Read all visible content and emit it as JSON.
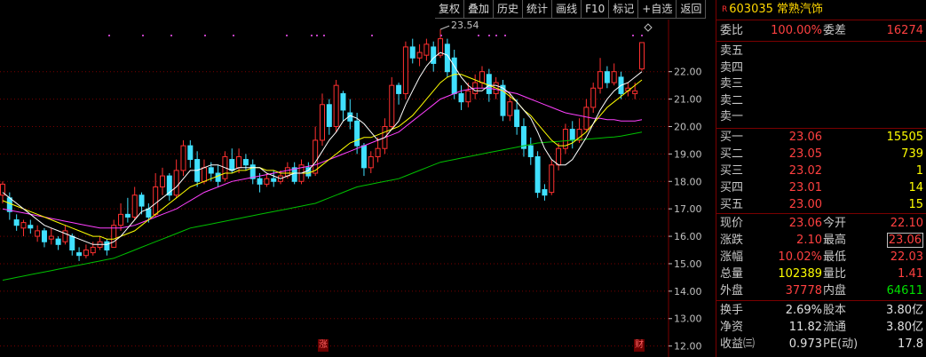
{
  "toolbar": {
    "buttons": [
      "复权",
      "叠加",
      "历史",
      "统计",
      "画线",
      "F10",
      "标记",
      "+自选",
      "返回"
    ]
  },
  "chart": {
    "max_label": "23.54",
    "price_ticks": [
      "22.00",
      "21.00",
      "20.00",
      "19.00",
      "18.00",
      "17.00",
      "16.00",
      "15.00",
      "14.00",
      "13.00",
      "12.00"
    ],
    "tags": {
      "zhang": "涨",
      "cai": "财"
    },
    "colors": {
      "up": "#ff3030",
      "down": "#40e0ff",
      "ma5": "#ffffff",
      "ma10": "#ffff00",
      "ma20": "#ff40ff",
      "ma60": "#00c000",
      "grid": "#7a0000"
    }
  },
  "chart_data": {
    "type": "candlestick",
    "ylim": [
      11.6,
      23.9
    ],
    "candles": [
      {
        "o": 17.5,
        "c": 17.9,
        "h": 18.0,
        "l": 17.2
      },
      {
        "o": 17.4,
        "c": 16.9,
        "h": 17.6,
        "l": 16.6
      },
      {
        "o": 16.6,
        "c": 16.4,
        "h": 16.8,
        "l": 16.2
      },
      {
        "o": 16.3,
        "c": 16.5,
        "h": 16.6,
        "l": 16.0
      },
      {
        "o": 16.4,
        "c": 16.3,
        "h": 16.6,
        "l": 16.1
      },
      {
        "o": 16.0,
        "c": 16.2,
        "h": 16.4,
        "l": 15.8
      },
      {
        "o": 16.2,
        "c": 15.8,
        "h": 16.3,
        "l": 15.6
      },
      {
        "o": 15.9,
        "c": 16.0,
        "h": 16.3,
        "l": 15.7
      },
      {
        "o": 15.9,
        "c": 15.7,
        "h": 16.0,
        "l": 15.5
      },
      {
        "o": 15.8,
        "c": 16.2,
        "h": 16.4,
        "l": 15.7
      },
      {
        "o": 16.0,
        "c": 15.5,
        "h": 16.1,
        "l": 15.3
      },
      {
        "o": 15.4,
        "c": 15.3,
        "h": 15.6,
        "l": 15.1
      },
      {
        "o": 15.3,
        "c": 15.5,
        "h": 15.7,
        "l": 15.2
      },
      {
        "o": 15.4,
        "c": 15.6,
        "h": 15.8,
        "l": 15.3
      },
      {
        "o": 15.6,
        "c": 15.8,
        "h": 16.0,
        "l": 15.5
      },
      {
        "o": 15.8,
        "c": 15.5,
        "h": 15.9,
        "l": 15.3
      },
      {
        "o": 15.6,
        "c": 16.4,
        "h": 16.6,
        "l": 15.6
      },
      {
        "o": 16.4,
        "c": 16.8,
        "h": 17.2,
        "l": 16.2
      },
      {
        "o": 16.8,
        "c": 16.7,
        "h": 17.4,
        "l": 16.5
      },
      {
        "o": 16.7,
        "c": 17.5,
        "h": 17.8,
        "l": 16.6
      },
      {
        "o": 17.5,
        "c": 17.1,
        "h": 17.6,
        "l": 16.8
      },
      {
        "o": 17.0,
        "c": 16.7,
        "h": 17.2,
        "l": 16.5
      },
      {
        "o": 16.8,
        "c": 17.8,
        "h": 18.3,
        "l": 16.7
      },
      {
        "o": 17.8,
        "c": 18.2,
        "h": 18.5,
        "l": 17.5
      },
      {
        "o": 18.2,
        "c": 17.5,
        "h": 18.3,
        "l": 17.3
      },
      {
        "o": 17.5,
        "c": 18.4,
        "h": 18.8,
        "l": 17.4
      },
      {
        "o": 18.4,
        "c": 19.3,
        "h": 19.5,
        "l": 18.2
      },
      {
        "o": 19.3,
        "c": 18.8,
        "h": 19.5,
        "l": 18.5
      },
      {
        "o": 18.8,
        "c": 18.0,
        "h": 19.1,
        "l": 17.8
      },
      {
        "o": 18.0,
        "c": 18.5,
        "h": 18.8,
        "l": 17.9
      },
      {
        "o": 18.5,
        "c": 18.3,
        "h": 18.7,
        "l": 18.0
      },
      {
        "o": 18.3,
        "c": 18.0,
        "h": 18.6,
        "l": 17.8
      },
      {
        "o": 18.1,
        "c": 18.9,
        "h": 19.1,
        "l": 18.0
      },
      {
        "o": 18.8,
        "c": 18.4,
        "h": 19.2,
        "l": 18.3
      },
      {
        "o": 18.5,
        "c": 18.9,
        "h": 19.2,
        "l": 18.3
      },
      {
        "o": 18.8,
        "c": 18.6,
        "h": 19.0,
        "l": 18.4
      },
      {
        "o": 18.6,
        "c": 18.1,
        "h": 18.8,
        "l": 17.9
      },
      {
        "o": 18.1,
        "c": 17.9,
        "h": 18.3,
        "l": 17.6
      },
      {
        "o": 17.9,
        "c": 18.1,
        "h": 18.3,
        "l": 17.8
      },
      {
        "o": 18.1,
        "c": 18.0,
        "h": 18.4,
        "l": 17.8
      },
      {
        "o": 18.0,
        "c": 18.2,
        "h": 18.4,
        "l": 17.9
      },
      {
        "o": 18.2,
        "c": 18.5,
        "h": 18.7,
        "l": 18.1
      },
      {
        "o": 18.5,
        "c": 18.0,
        "h": 18.7,
        "l": 17.9
      },
      {
        "o": 18.0,
        "c": 18.6,
        "h": 18.8,
        "l": 17.9
      },
      {
        "o": 18.5,
        "c": 18.2,
        "h": 18.7,
        "l": 18.1
      },
      {
        "o": 18.3,
        "c": 19.5,
        "h": 20.0,
        "l": 18.2
      },
      {
        "o": 19.5,
        "c": 20.8,
        "h": 21.2,
        "l": 19.3
      },
      {
        "o": 20.8,
        "c": 20.0,
        "h": 21.0,
        "l": 19.7
      },
      {
        "o": 20.0,
        "c": 21.5,
        "h": 21.7,
        "l": 19.8
      },
      {
        "o": 21.2,
        "c": 20.6,
        "h": 21.3,
        "l": 20.2
      },
      {
        "o": 20.5,
        "c": 20.2,
        "h": 21.0,
        "l": 19.9
      },
      {
        "o": 20.2,
        "c": 19.3,
        "h": 20.5,
        "l": 19.0
      },
      {
        "o": 19.3,
        "c": 18.5,
        "h": 19.4,
        "l": 18.2
      },
      {
        "o": 18.5,
        "c": 18.9,
        "h": 19.1,
        "l": 18.3
      },
      {
        "o": 18.9,
        "c": 19.2,
        "h": 19.6,
        "l": 18.7
      },
      {
        "o": 19.2,
        "c": 20.0,
        "h": 20.3,
        "l": 19.0
      },
      {
        "o": 20.0,
        "c": 21.5,
        "h": 21.8,
        "l": 19.9
      },
      {
        "o": 21.5,
        "c": 21.2,
        "h": 21.6,
        "l": 20.8
      },
      {
        "o": 21.2,
        "c": 22.9,
        "h": 23.1,
        "l": 21.0
      },
      {
        "o": 22.9,
        "c": 22.5,
        "h": 23.2,
        "l": 22.3
      },
      {
        "o": 22.5,
        "c": 22.7,
        "h": 23.0,
        "l": 22.2
      },
      {
        "o": 22.6,
        "c": 23.0,
        "h": 23.2,
        "l": 22.4
      },
      {
        "o": 22.9,
        "c": 22.3,
        "h": 23.1,
        "l": 22.0
      },
      {
        "o": 22.6,
        "c": 23.2,
        "h": 23.54,
        "l": 22.5
      },
      {
        "o": 23.0,
        "c": 22.0,
        "h": 23.2,
        "l": 21.8
      },
      {
        "o": 22.5,
        "c": 21.2,
        "h": 22.8,
        "l": 21.0
      },
      {
        "o": 21.2,
        "c": 20.9,
        "h": 21.5,
        "l": 20.6
      },
      {
        "o": 20.9,
        "c": 21.3,
        "h": 21.6,
        "l": 20.7
      },
      {
        "o": 21.2,
        "c": 21.6,
        "h": 21.9,
        "l": 21.0
      },
      {
        "o": 21.6,
        "c": 22.0,
        "h": 22.2,
        "l": 21.4
      },
      {
        "o": 21.9,
        "c": 21.2,
        "h": 22.1,
        "l": 20.9
      },
      {
        "o": 21.2,
        "c": 21.6,
        "h": 21.8,
        "l": 21.0
      },
      {
        "o": 21.5,
        "c": 20.4,
        "h": 21.7,
        "l": 20.2
      },
      {
        "o": 20.4,
        "c": 20.9,
        "h": 21.2,
        "l": 20.2
      },
      {
        "o": 20.6,
        "c": 20.0,
        "h": 21.0,
        "l": 19.7
      },
      {
        "o": 20.0,
        "c": 19.2,
        "h": 20.3,
        "l": 18.9
      },
      {
        "o": 19.3,
        "c": 18.9,
        "h": 19.6,
        "l": 18.6
      },
      {
        "o": 18.9,
        "c": 17.6,
        "h": 19.1,
        "l": 17.4
      },
      {
        "o": 17.7,
        "c": 17.5,
        "h": 17.9,
        "l": 17.3
      },
      {
        "o": 17.6,
        "c": 18.6,
        "h": 18.8,
        "l": 17.5
      },
      {
        "o": 18.6,
        "c": 19.2,
        "h": 19.4,
        "l": 18.4
      },
      {
        "o": 19.2,
        "c": 19.9,
        "h": 20.1,
        "l": 19.0
      },
      {
        "o": 19.9,
        "c": 19.5,
        "h": 20.2,
        "l": 19.2
      },
      {
        "o": 19.5,
        "c": 19.9,
        "h": 20.3,
        "l": 19.4
      },
      {
        "o": 19.9,
        "c": 20.7,
        "h": 21.0,
        "l": 19.8
      },
      {
        "o": 20.7,
        "c": 21.4,
        "h": 21.6,
        "l": 20.5
      },
      {
        "o": 21.4,
        "c": 22.0,
        "h": 22.5,
        "l": 21.2
      },
      {
        "o": 22.0,
        "c": 21.6,
        "h": 22.2,
        "l": 21.4
      },
      {
        "o": 21.6,
        "c": 22.0,
        "h": 22.3,
        "l": 21.5
      },
      {
        "o": 21.8,
        "c": 21.2,
        "h": 22.0,
        "l": 21.0
      },
      {
        "o": 21.3,
        "c": 21.4,
        "h": 21.6,
        "l": 21.1
      },
      {
        "o": 21.2,
        "c": 21.3,
        "h": 21.6,
        "l": 21.0
      },
      {
        "o": 22.1,
        "c": 23.06,
        "h": 23.06,
        "l": 22.03
      }
    ],
    "ma5": [
      17.6,
      17.4,
      17.2,
      17.0,
      16.8,
      16.6,
      16.4,
      16.3,
      16.2,
      16.1,
      16.0,
      15.9,
      15.8,
      15.7,
      15.7,
      15.7,
      15.8,
      16.0,
      16.3,
      16.6,
      16.9,
      17.0,
      17.2,
      17.4,
      17.6,
      17.8,
      18.1,
      18.4,
      18.4,
      18.5,
      18.6,
      18.6,
      18.5,
      18.4,
      18.5,
      18.5,
      18.5,
      18.5,
      18.3,
      18.2,
      18.1,
      18.2,
      18.3,
      18.3,
      18.4,
      18.7,
      19.1,
      19.5,
      19.8,
      20.2,
      20.4,
      20.3,
      20.1,
      19.8,
      19.5,
      19.6,
      19.9,
      20.2,
      20.8,
      21.3,
      21.8,
      22.2,
      22.5,
      22.7,
      22.6,
      22.2,
      21.8,
      21.5,
      21.3,
      21.3,
      21.5,
      21.5,
      21.4,
      21.2,
      20.9,
      20.6,
      20.3,
      19.8,
      19.2,
      18.8,
      18.6,
      18.6,
      18.8,
      19.2,
      19.6,
      20.1,
      20.6,
      21.0,
      21.3,
      21.5,
      21.6,
      21.8,
      22.0
    ],
    "ma10": [
      17.3,
      17.2,
      17.1,
      17.0,
      16.9,
      16.8,
      16.7,
      16.6,
      16.5,
      16.4,
      16.3,
      16.2,
      16.1,
      16.0,
      16.0,
      15.9,
      15.9,
      16.0,
      16.1,
      16.2,
      16.4,
      16.6,
      16.8,
      17.0,
      17.2,
      17.4,
      17.6,
      17.8,
      17.9,
      18.0,
      18.1,
      18.2,
      18.3,
      18.3,
      18.4,
      18.4,
      18.5,
      18.5,
      18.4,
      18.4,
      18.3,
      18.3,
      18.3,
      18.3,
      18.3,
      18.4,
      18.6,
      18.8,
      19.0,
      19.2,
      19.4,
      19.5,
      19.6,
      19.6,
      19.7,
      19.8,
      19.9,
      20.0,
      20.2,
      20.4,
      20.7,
      21.0,
      21.3,
      21.6,
      21.8,
      21.9,
      21.9,
      21.8,
      21.7,
      21.6,
      21.5,
      21.4,
      21.3,
      21.1,
      20.9,
      20.6,
      20.4,
      20.1,
      19.8,
      19.5,
      19.3,
      19.3,
      19.4,
      19.6,
      19.8,
      20.1,
      20.4,
      20.7,
      20.9,
      21.1,
      21.3,
      21.5,
      21.7
    ],
    "ma20": [
      17.0,
      16.95,
      16.9,
      16.85,
      16.8,
      16.75,
      16.7,
      16.65,
      16.6,
      16.55,
      16.5,
      16.45,
      16.4,
      16.35,
      16.3,
      16.3,
      16.3,
      16.3,
      16.35,
      16.4,
      16.5,
      16.6,
      16.7,
      16.8,
      16.9,
      17.0,
      17.15,
      17.3,
      17.45,
      17.6,
      17.7,
      17.8,
      17.9,
      18.0,
      18.05,
      18.1,
      18.15,
      18.2,
      18.25,
      18.3,
      18.35,
      18.4,
      18.45,
      18.5,
      18.55,
      18.6,
      18.7,
      18.8,
      18.9,
      19.0,
      19.1,
      19.2,
      19.3,
      19.4,
      19.5,
      19.6,
      19.7,
      19.8,
      20.0,
      20.2,
      20.4,
      20.6,
      20.8,
      21.0,
      21.1,
      21.2,
      21.3,
      21.35,
      21.4,
      21.4,
      21.4,
      21.35,
      21.3,
      21.25,
      21.2,
      21.1,
      21.0,
      20.9,
      20.8,
      20.7,
      20.6,
      20.5,
      20.45,
      20.4,
      20.35,
      20.3,
      20.3,
      20.25,
      20.25,
      20.2,
      20.2,
      20.2,
      20.25
    ],
    "ma60": [
      14.4,
      14.45,
      14.5,
      14.55,
      14.6,
      14.65,
      14.7,
      14.75,
      14.8,
      14.85,
      14.9,
      14.95,
      15.0,
      15.05,
      15.1,
      15.15,
      15.2,
      15.3,
      15.4,
      15.5,
      15.6,
      15.7,
      15.8,
      15.9,
      16.0,
      16.1,
      16.2,
      16.3,
      16.35,
      16.4,
      16.45,
      16.5,
      16.55,
      16.6,
      16.65,
      16.7,
      16.75,
      16.8,
      16.85,
      16.9,
      16.95,
      17.0,
      17.05,
      17.1,
      17.15,
      17.2,
      17.3,
      17.4,
      17.5,
      17.6,
      17.7,
      17.8,
      17.85,
      17.9,
      17.95,
      18.0,
      18.05,
      18.1,
      18.2,
      18.3,
      18.4,
      18.5,
      18.6,
      18.7,
      18.75,
      18.8,
      18.85,
      18.9,
      18.95,
      19.0,
      19.05,
      19.1,
      19.15,
      19.2,
      19.25,
      19.3,
      19.35,
      19.4,
      19.42,
      19.44,
      19.46,
      19.48,
      19.5,
      19.52,
      19.54,
      19.56,
      19.58,
      19.6,
      19.62,
      19.65,
      19.7,
      19.75,
      19.8
    ]
  },
  "quote": {
    "code": "603035",
    "name": "常熟汽饰",
    "r_mark": "R",
    "webi_label": "委比",
    "webi_value": "100.00%",
    "wecha_label": "委差",
    "wecha_value": "16274",
    "sell": [
      {
        "label": "卖五"
      },
      {
        "label": "卖四"
      },
      {
        "label": "卖三"
      },
      {
        "label": "卖二"
      },
      {
        "label": "卖一"
      }
    ],
    "buy": [
      {
        "label": "买一",
        "price": "23.06",
        "vol": "15505"
      },
      {
        "label": "买二",
        "price": "23.05",
        "vol": "739"
      },
      {
        "label": "买三",
        "price": "23.02",
        "vol": "1"
      },
      {
        "label": "买四",
        "price": "23.01",
        "vol": "14"
      },
      {
        "label": "买五",
        "price": "23.00",
        "vol": "15"
      }
    ],
    "stats": [
      {
        "l1": "现价",
        "v1": "23.06",
        "l2": "今开",
        "v2": "22.10"
      },
      {
        "l1": "涨跌",
        "v1": "2.10",
        "l2": "最高",
        "v2": "23.06"
      },
      {
        "l1": "涨幅",
        "v1": "10.02%",
        "l2": "最低",
        "v2": "22.03"
      },
      {
        "l1": "总量",
        "v1": "102389",
        "l2": "量比",
        "v2": "1.41"
      },
      {
        "l1": "外盘",
        "v1": "37778",
        "l2": "内盘",
        "v2": "64611"
      }
    ],
    "fund": [
      {
        "l1": "换手",
        "v1": "2.69%",
        "l2": "股本",
        "v2": "3.80亿"
      },
      {
        "l1": "净资",
        "v1": "11.82",
        "l2": "流通",
        "v2": "3.80亿"
      },
      {
        "l1": "收益㈢",
        "v1": "0.973",
        "l2": "PE(动)",
        "v2": "17.8"
      }
    ]
  }
}
